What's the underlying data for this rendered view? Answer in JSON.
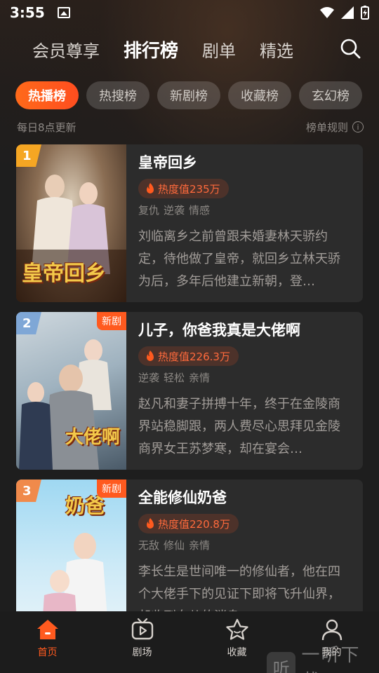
{
  "status": {
    "time": "3:55"
  },
  "top_nav": {
    "tabs": [
      "会员尊享",
      "排行榜",
      "剧单",
      "精选"
    ],
    "active_index": 1
  },
  "chips": {
    "items": [
      "热播榜",
      "热搜榜",
      "新剧榜",
      "收藏榜",
      "玄幻榜"
    ],
    "active_index": 0
  },
  "update_note": "每日8点更新",
  "rules_label": "榜单规则",
  "cards": [
    {
      "rank": "1",
      "rank_color": "#f5a623",
      "new_tag": "",
      "poster_title": "皇帝回乡",
      "title": "皇帝回乡",
      "heat": "热度值235万",
      "tags": [
        "复仇",
        "逆袭",
        "情感"
      ],
      "desc": "刘临离乡之前曾跟未婚妻林天骄约定，待他做了皇帝，就回乡立林天骄为后，多年后他建立新朝，登…"
    },
    {
      "rank": "2",
      "rank_color": "#7fa7d6",
      "new_tag": "新剧",
      "poster_title": "大佬啊",
      "title": "儿子，你爸我真是大佬啊",
      "heat": "热度值226.3万",
      "tags": [
        "逆袭",
        "轻松",
        "亲情"
      ],
      "desc": "赵凡和妻子拼搏十年，终于在金陵商界站稳脚跟，两人费尽心思拜见金陵商界女王苏梦寒，却在宴会…"
    },
    {
      "rank": "3",
      "rank_color": "#f08a4b",
      "new_tag": "新剧",
      "poster_title": "奶爸",
      "title": "全能修仙奶爸",
      "heat": "热度值220.8万",
      "tags": [
        "无敌",
        "修仙",
        "亲情"
      ],
      "desc": "李长生是世间唯一的修仙者，他在四个大佬手下的见证下即将飞升仙界，却收到女儿的消息…"
    }
  ],
  "bottom_nav": {
    "items": [
      "首页",
      "剧场",
      "收藏",
      "我的"
    ],
    "active_index": 0
  },
  "watermark": {
    "badge": "听",
    "text": "一听下载"
  },
  "colors": {
    "accent": "#ff5a1f",
    "background": "#1e1e1e",
    "card": "#2c2c2c"
  }
}
